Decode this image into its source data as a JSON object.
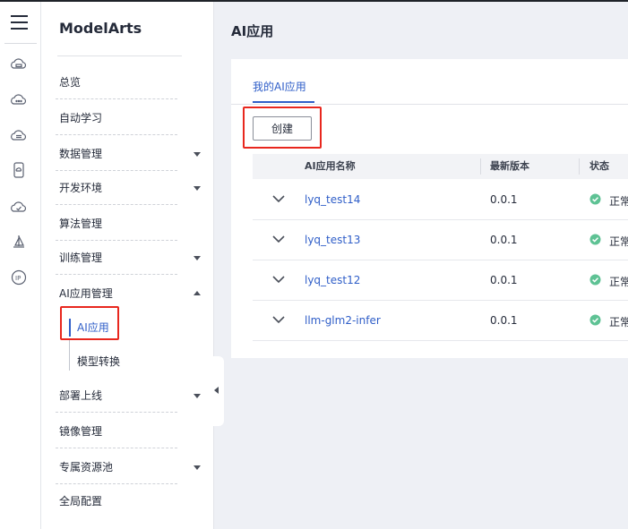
{
  "rail": {
    "icons": [
      "menu-icon",
      "cloud-box-icon",
      "cloud-dots-icon",
      "cloud-stack-icon",
      "phone-cloud-icon",
      "cloud-check-icon",
      "sailboat-icon",
      "ip-icon"
    ]
  },
  "nav": {
    "brand": "ModelArts",
    "items": [
      {
        "label": "总览"
      },
      {
        "label": "自动学习"
      },
      {
        "label": "数据管理"
      },
      {
        "label": "开发环境"
      },
      {
        "label": "算法管理"
      },
      {
        "label": "训练管理"
      },
      {
        "label": "AI应用管理"
      },
      {
        "label": "部署上线"
      },
      {
        "label": "镜像管理"
      },
      {
        "label": "专属资源池"
      },
      {
        "label": "全局配置"
      }
    ],
    "subitems": [
      {
        "label": "AI应用",
        "active": true
      },
      {
        "label": "模型转换",
        "active": false
      }
    ]
  },
  "page": {
    "title": "AI应用",
    "tab": "我的AI应用",
    "create_label": "创建"
  },
  "table": {
    "headers": [
      "AI应用名称",
      "最新版本",
      "状态"
    ],
    "rows": [
      {
        "name": "lyq_test14",
        "version": "0.0.1",
        "status": "正常"
      },
      {
        "name": "lyq_test13",
        "version": "0.0.1",
        "status": "正常"
      },
      {
        "name": "lyq_test12",
        "version": "0.0.1",
        "status": "正常"
      },
      {
        "name": "llm-glm2-infer",
        "version": "0.0.1",
        "status": "正常"
      }
    ]
  },
  "colors": {
    "accent": "#2f5ec8",
    "highlight": "#e8271e",
    "status_ok": "#5ec294"
  }
}
